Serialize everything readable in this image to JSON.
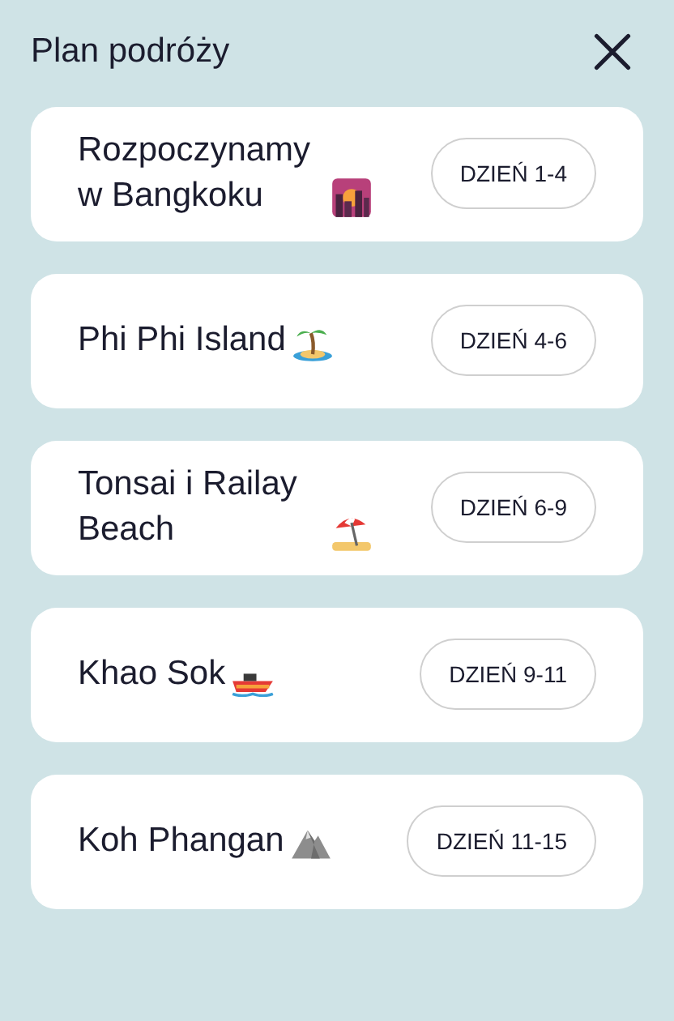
{
  "header": {
    "title": "Plan podróży"
  },
  "stages": [
    {
      "title": "Rozpoczynamy w Bangkoku",
      "days": "DZIEŃ 1-4"
    },
    {
      "title": "Phi Phi Island",
      "days": "DZIEŃ 4-6"
    },
    {
      "title": "Tonsai i Railay Beach",
      "days": "DZIEŃ 6-9"
    },
    {
      "title": "Khao Sok",
      "days": "DZIEŃ 9-11"
    },
    {
      "title": "Koh Phangan",
      "days": "DZIEŃ 11-15"
    }
  ]
}
